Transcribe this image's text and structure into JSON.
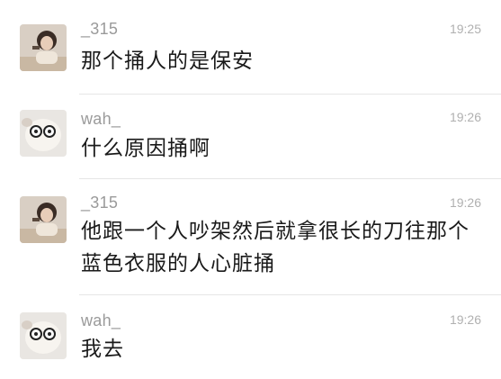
{
  "messages": [
    {
      "sender": "_315",
      "time": "19:25",
      "text": "那个捅人的是保安",
      "avatar": "avatar-girl"
    },
    {
      "sender": "wah_",
      "time": "19:26",
      "text": "什么原因捅啊",
      "avatar": "avatar-plush-toy"
    },
    {
      "sender": "_315",
      "time": "19:26",
      "text": "他跟一个人吵架然后就拿很长的刀往那个蓝色衣服的人心脏捅",
      "avatar": "avatar-girl"
    },
    {
      "sender": "wah_",
      "time": "19:26",
      "text": "我去",
      "avatar": "avatar-plush-toy"
    }
  ]
}
